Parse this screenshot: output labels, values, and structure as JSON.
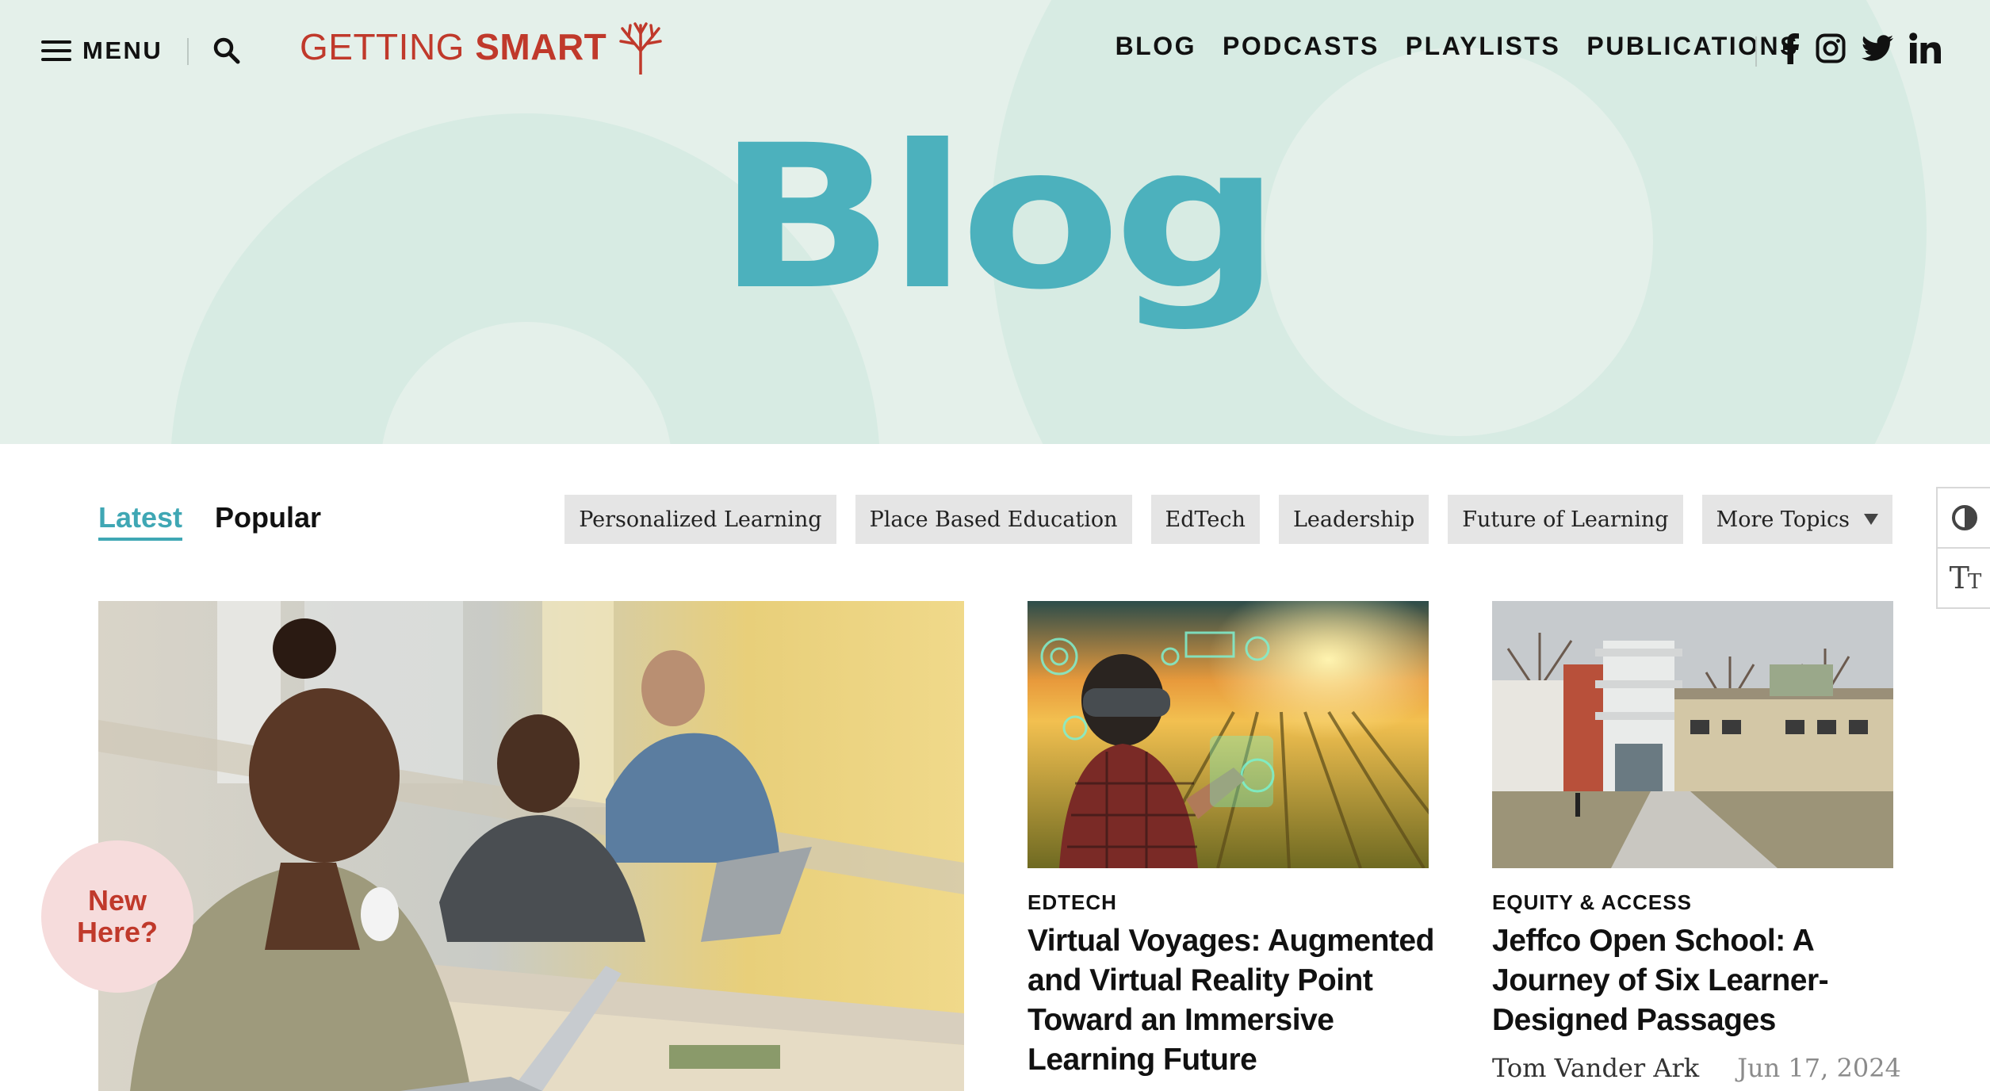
{
  "header": {
    "menu_label": "MENU",
    "logo": {
      "word1": "GETTING",
      "word2": "SMART",
      "color": "#c0392b"
    },
    "nav": [
      {
        "label": "BLOG"
      },
      {
        "label": "PODCASTS"
      },
      {
        "label": "PLAYLISTS"
      },
      {
        "label": "PUBLICATIONS"
      }
    ],
    "social": [
      "facebook-icon",
      "instagram-icon",
      "twitter-icon",
      "linkedin-icon"
    ]
  },
  "hero": {
    "title": "Blog",
    "title_color": "#4cb1bd",
    "background": "#e4f0ea"
  },
  "filters": {
    "tabs": [
      {
        "label": "Latest",
        "active": true
      },
      {
        "label": "Popular",
        "active": false
      }
    ],
    "topics": [
      {
        "label": "Personalized Learning"
      },
      {
        "label": "Place Based Education"
      },
      {
        "label": "EdTech"
      },
      {
        "label": "Leadership"
      },
      {
        "label": "Future of Learning"
      }
    ],
    "more_topics": "More Topics"
  },
  "side_tools": {
    "contrast": "contrast-icon",
    "text_size": "text-size-icon",
    "text_size_glyph": "T",
    "text_size_glyph_small": "T"
  },
  "cards": [
    {
      "category": "EdTech",
      "title": "Virtual Voyages: Augmented and Virtual Reality Point Toward an Immersive Learning Future"
    },
    {
      "category": "Equity & Access",
      "title": "Jeffco Open School: A Journey of Six Learner-Designed Passages",
      "author": "Tom Vander Ark",
      "date": "Jun 17, 2024"
    }
  ],
  "new_here": {
    "line1": "New",
    "line2": "Here?"
  },
  "colors": {
    "accent": "#3fa7b4",
    "brand_red": "#c0392b",
    "chip_bg": "#e5e5e5"
  }
}
